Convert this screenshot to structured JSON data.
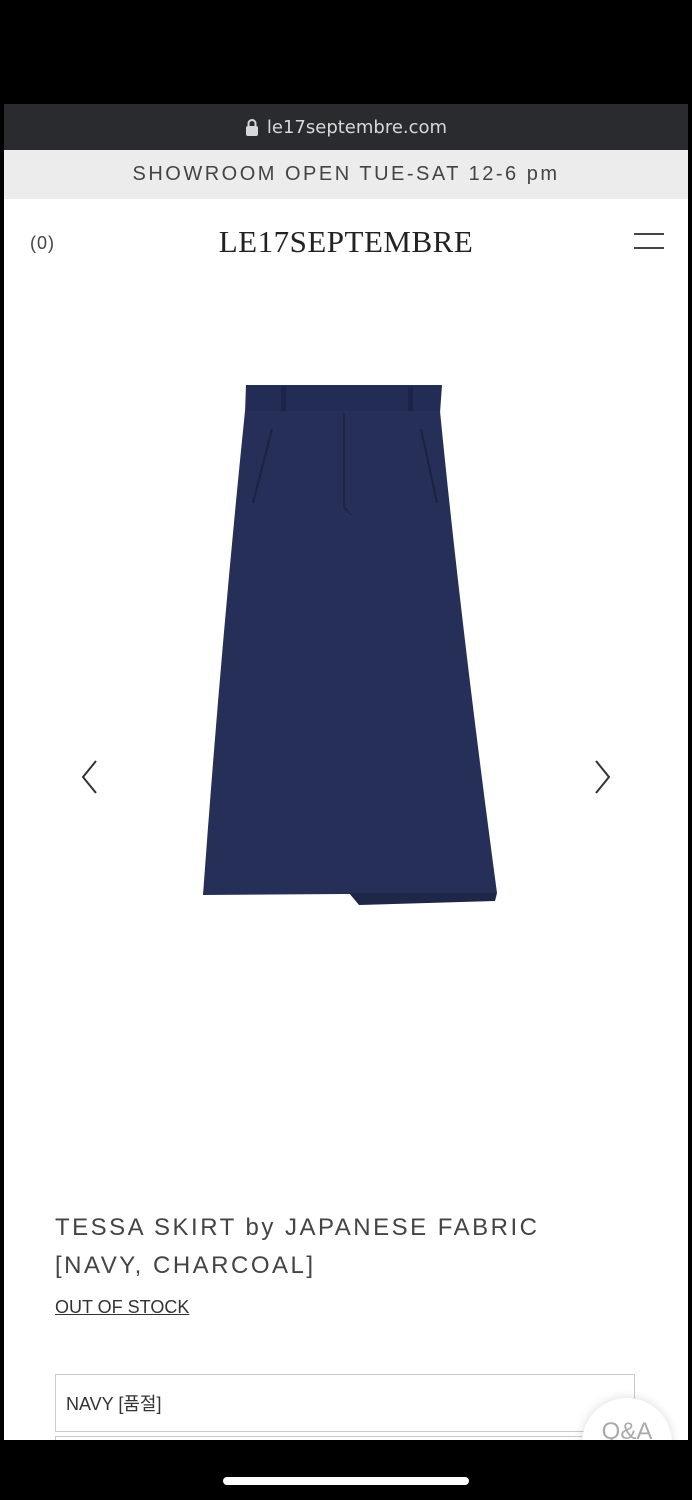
{
  "browser": {
    "url": "le17septembre.com"
  },
  "notice": {
    "text": "SHOWROOM OPEN TUE-SAT 12-6 pm"
  },
  "header": {
    "cart": "(0)",
    "logo": "LE17SEPTEMBRE"
  },
  "gallery": {
    "image": "navy-skirt",
    "prev_icon": "chevron-left-icon",
    "next_icon": "chevron-right-icon"
  },
  "product": {
    "title_line1": "TESSA SKIRT by JAPANESE FABRIC",
    "title_line2": "[NAVY, CHARCOAL]",
    "stock_status": "OUT OF STOCK",
    "option_selected": "NAVY [품절]"
  },
  "qa_button": {
    "label": "Q&A"
  },
  "colors": {
    "skirt": "#262f58",
    "notice_bg": "#ececec",
    "url_bar": "#2a2b2e"
  }
}
